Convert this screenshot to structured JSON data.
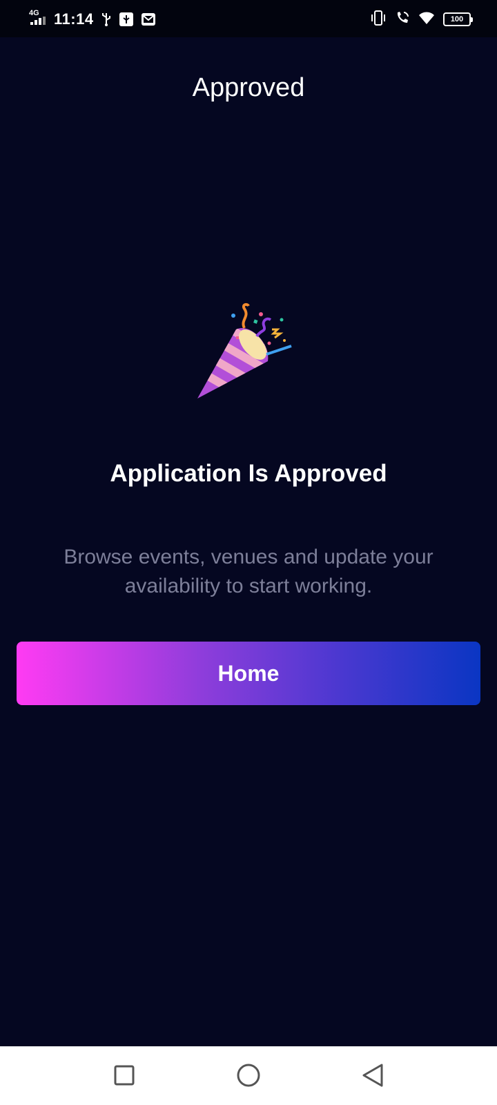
{
  "status_bar": {
    "network": "4G",
    "time": "11:14",
    "battery": "100"
  },
  "page": {
    "title": "Approved",
    "hero_icon": "party-popper-icon",
    "headline": "Application Is Approved",
    "subtext": "Browse events, venues and update your availability to start working.",
    "home_button_label": "Home"
  },
  "colors": {
    "background": "#050721",
    "subtext": "#7d7f99",
    "button_gradient_start": "#ff3bf3",
    "button_gradient_end": "#0a36c3"
  },
  "nav_bar": {
    "items": [
      "recents-button",
      "home-nav-button",
      "back-button"
    ]
  }
}
